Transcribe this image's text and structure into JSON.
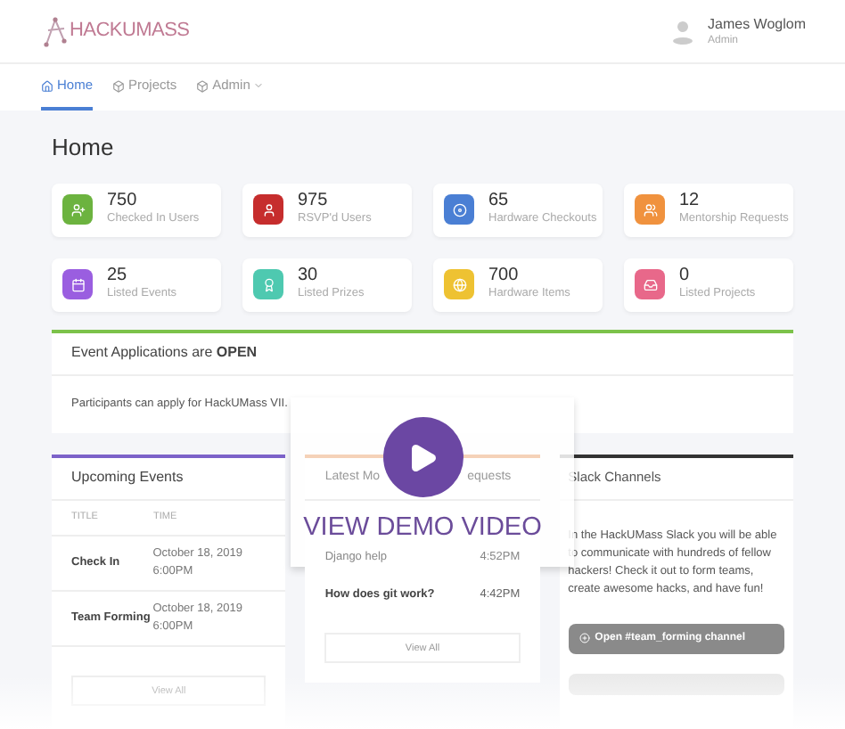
{
  "header": {
    "logo": "HACKUMASS",
    "user": {
      "name": "James Woglom",
      "role": "Admin"
    }
  },
  "nav": [
    {
      "label": "Home",
      "selected": true,
      "kind": "link"
    },
    {
      "label": "Projects",
      "selected": false,
      "kind": "link"
    },
    {
      "label": "Admin",
      "selected": false,
      "kind": "dropdown"
    }
  ],
  "page_title": "Home",
  "stats": [
    {
      "value": "750",
      "label": "Checked In Users",
      "color": "#6cb33f",
      "kind": "user-plus"
    },
    {
      "value": "975",
      "label": "RSVP'd Users",
      "color": "#c62d2d",
      "kind": "user"
    },
    {
      "value": "65",
      "label": "Hardware Checkouts",
      "color": "#4a7fd4",
      "kind": "disc"
    },
    {
      "value": "12",
      "label": "Mentorship Requests",
      "color": "#f0923e",
      "kind": "users"
    },
    {
      "value": "25",
      "label": "Listed Events",
      "color": "#9a5ee0",
      "kind": "calendar"
    },
    {
      "value": "30",
      "label": "Listed Prizes",
      "color": "#4ec9b0",
      "kind": "award"
    },
    {
      "value": "700",
      "label": "Hardware Items",
      "color": "#eec232",
      "kind": "globe"
    },
    {
      "value": "0",
      "label": "Listed Projects",
      "color": "#e8688a",
      "kind": "inbox"
    }
  ],
  "applications": {
    "title": "Event Applications are **OPEN**",
    "body": "Participants can apply for HackUMass VII.",
    "color": "#7cc24a"
  },
  "upcoming_events": {
    "title": "Upcoming Events",
    "color": "#7c62c9",
    "columns": [
      "TITLE",
      "TIME"
    ],
    "rows": [
      [
        "Check In",
        "October 18, 2019 6:00PM"
      ],
      [
        "Team Forming",
        "October 18, 2019 6:00PM"
      ]
    ],
    "button": "View All"
  },
  "mentorship": {
    "title_start": "Latest Mo",
    "title_end": "equests",
    "color": "#f5d2b8",
    "rows": [
      [
        "Django help",
        "4:52PM"
      ],
      [
        "How does git work?",
        "4:42PM"
      ]
    ],
    "button": "View All"
  },
  "slack": {
    "title": "Slack Channels",
    "color": "#333333",
    "body": "In the HackUMass Slack you will be able to communicate with hundreds of fellow hackers! Check it out to form teams, create awesome hacks, and have fun!",
    "button": "Open #team_forming channel"
  },
  "video_overlay": {
    "label": "VIEW DEMO VIDEO"
  }
}
